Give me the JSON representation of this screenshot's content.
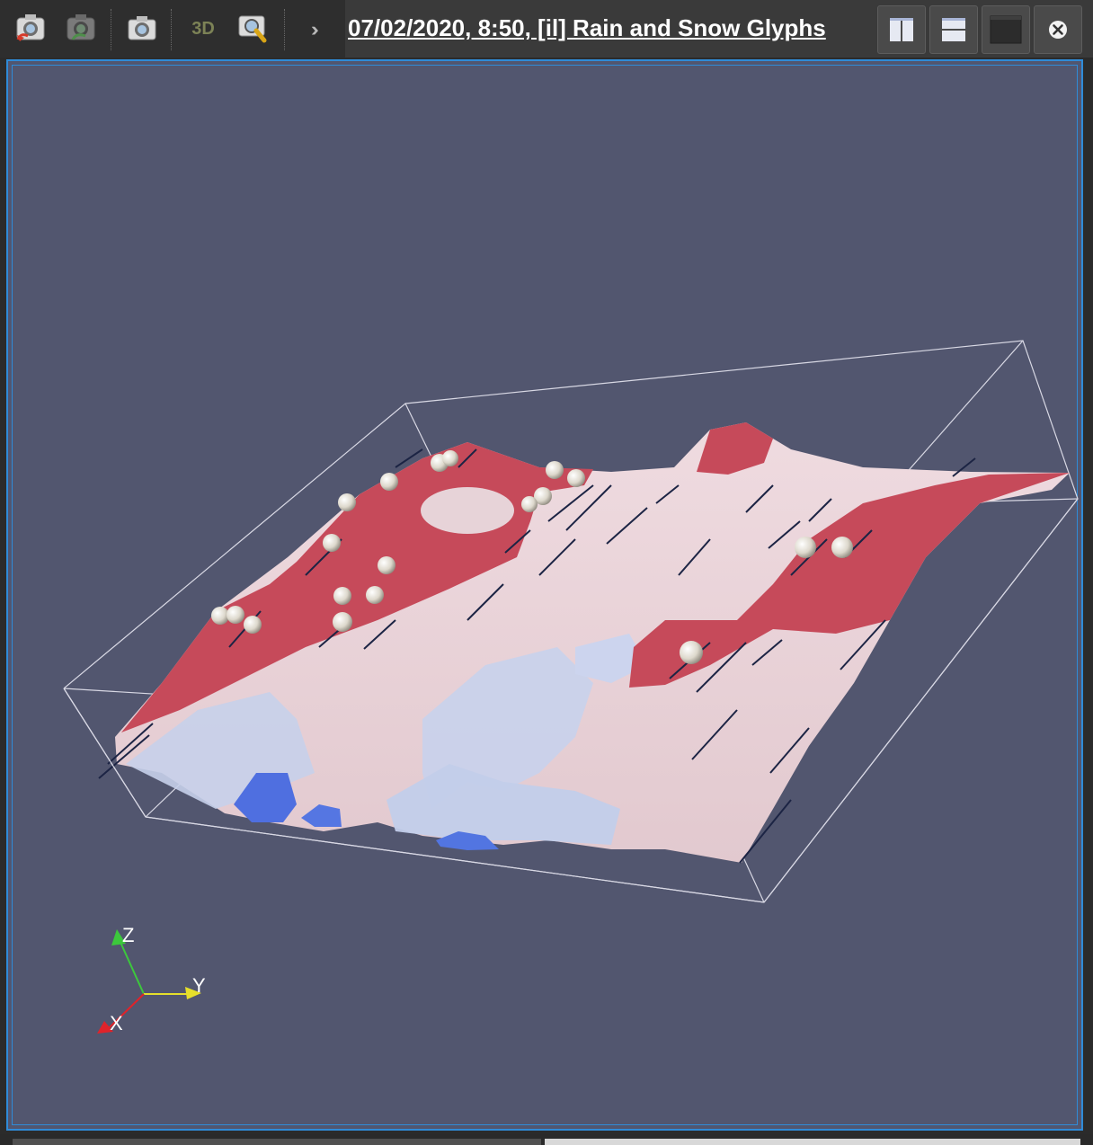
{
  "toolbar": {
    "buttons": [
      {
        "name": "reset-camera",
        "icon": "camera-reset-icon"
      },
      {
        "name": "undo-camera",
        "icon": "camera-undo-icon"
      },
      {
        "name": "snapshot",
        "icon": "camera-icon"
      },
      {
        "name": "toggle-3d",
        "label": "3D"
      },
      {
        "name": "zoom-to-box",
        "icon": "magnify-icon"
      }
    ],
    "label_3d": "3D",
    "overflow_icon": "double-chevron-icon"
  },
  "view": {
    "title": "07/02/2020, 8:50, [il] Rain and Snow Glyphs"
  },
  "window_controls": [
    {
      "name": "split-horizontal",
      "icon": "split-vertical-icon"
    },
    {
      "name": "split-vertical",
      "icon": "split-horizontal-icon"
    },
    {
      "name": "maximize",
      "icon": "maximize-icon"
    },
    {
      "name": "close",
      "icon": "close-icon"
    }
  ],
  "orientation_axes": {
    "x": "X",
    "y": "Y",
    "z": "Z"
  },
  "colors": {
    "background": "#52566f",
    "accent": "#2f8bd8",
    "surface_high": "#c64a5a",
    "surface_mid": "#ead7db",
    "surface_low": "#bcc9ea",
    "surface_deep": "#4f6fe0",
    "axis_x": "#e0232a",
    "axis_y": "#e6df2b",
    "axis_z": "#3cc83c"
  }
}
